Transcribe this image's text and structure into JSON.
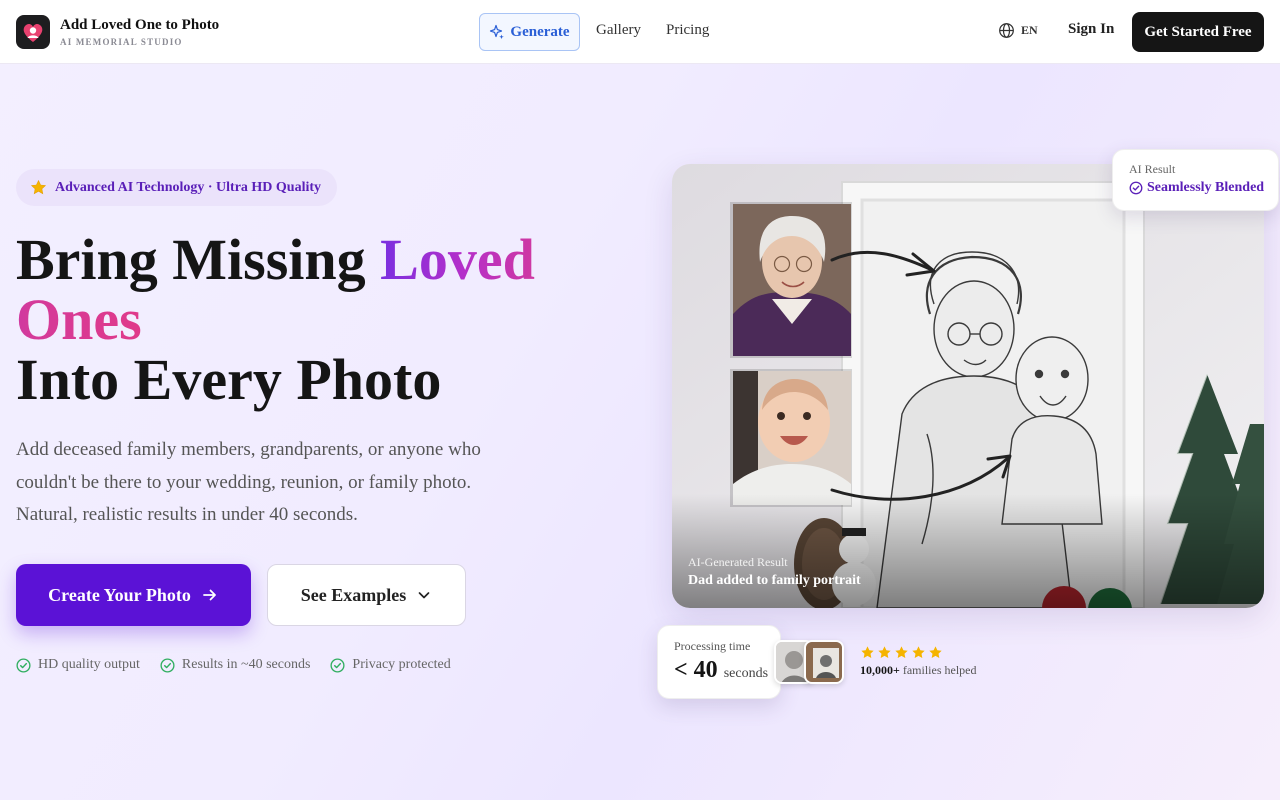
{
  "header": {
    "brand_title": "Add Loved One to Photo",
    "brand_subtitle": "AI MEMORIAL STUDIO",
    "nav": {
      "generate": "Generate",
      "gallery": "Gallery",
      "pricing": "Pricing"
    },
    "language": "EN",
    "sign_in": "Sign In",
    "get_started": "Get Started Free"
  },
  "hero": {
    "badge": "Advanced AI Technology · Ultra HD Quality",
    "headline_part1": "Bring Missing ",
    "headline_highlight": "Loved Ones",
    "headline_part2": "Into Every Photo",
    "lead": "Add deceased family members, grandparents, or anyone who couldn't be there to your wedding, reunion, or family photo. Natural, realistic results in under 40 seconds.",
    "primary_cta": "Create Your Photo",
    "secondary_cta": "See Examples",
    "features": [
      "HD quality output",
      "Results in ~40 seconds",
      "Privacy protected"
    ]
  },
  "showcase": {
    "caption_label": "AI-Generated Result",
    "caption_text": "Dad added to family portrait",
    "result_badge_label": "AI Result",
    "result_badge_value": "Seamlessly Blended",
    "processing_label": "Processing time",
    "processing_value": "< 40",
    "processing_unit": "seconds",
    "rating_stars": 5,
    "families_count": "10,000+",
    "families_text": "families helped"
  },
  "colors": {
    "accent_purple": "#5b12d6",
    "badge_text": "#5a1fb8",
    "generate_blue": "#2a5fd6",
    "check_green": "#2fae5f",
    "star_gold": "#f5b400"
  }
}
